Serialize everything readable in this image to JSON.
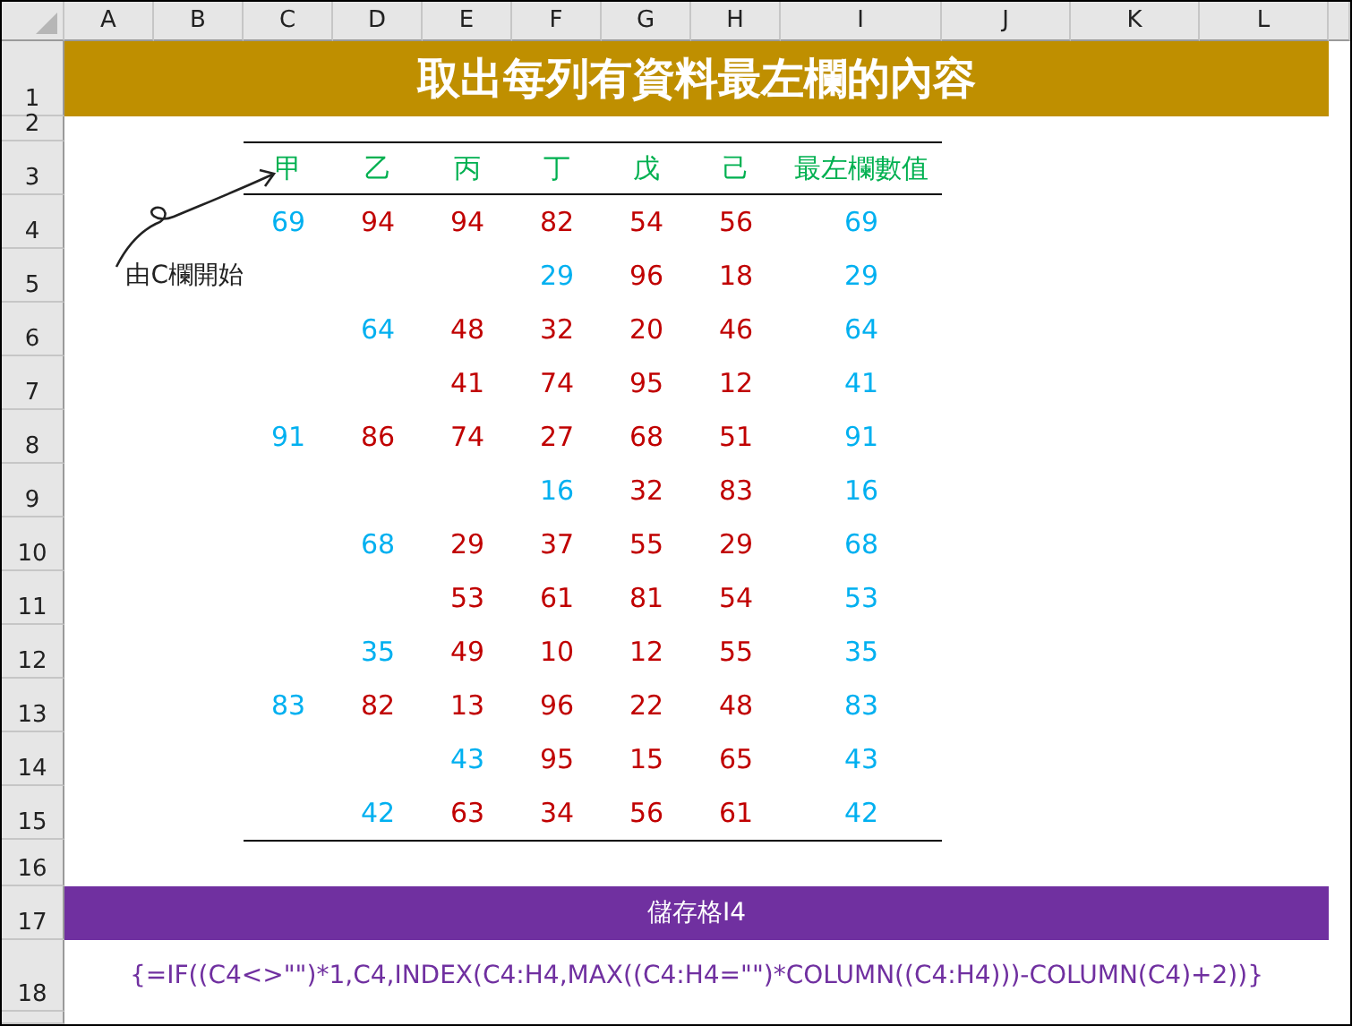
{
  "columns": [
    "A",
    "B",
    "C",
    "D",
    "E",
    "F",
    "G",
    "H",
    "I",
    "J",
    "K",
    "L"
  ],
  "row_numbers": [
    "1",
    "2",
    "3",
    "4",
    "5",
    "6",
    "7",
    "8",
    "9",
    "10",
    "11",
    "12",
    "13",
    "14",
    "15",
    "16",
    "17",
    "18"
  ],
  "title": "取出每列有資料最左欄的內容",
  "table": {
    "headers": [
      "甲",
      "乙",
      "丙",
      "丁",
      "戊",
      "己",
      "最左欄數值"
    ],
    "rows": [
      {
        "cells": [
          {
            "value": "69",
            "highlighted": true
          },
          {
            "value": "94",
            "highlighted": false
          },
          {
            "value": "94",
            "highlighted": false
          },
          {
            "value": "82",
            "highlighted": false
          },
          {
            "value": "54",
            "highlighted": false
          },
          {
            "value": "56",
            "highlighted": false
          }
        ],
        "result": "69"
      },
      {
        "cells": [
          null,
          null,
          null,
          {
            "value": "29",
            "highlighted": true
          },
          {
            "value": "96",
            "highlighted": false
          },
          {
            "value": "18",
            "highlighted": false
          }
        ],
        "result": "29"
      },
      {
        "cells": [
          null,
          {
            "value": "64",
            "highlighted": true
          },
          {
            "value": "48",
            "highlighted": false
          },
          {
            "value": "32",
            "highlighted": false
          },
          {
            "value": "20",
            "highlighted": false
          },
          {
            "value": "46",
            "highlighted": false
          }
        ],
        "result": "64"
      },
      {
        "cells": [
          null,
          null,
          {
            "value": "41",
            "highlighted": false
          },
          {
            "value": "74",
            "highlighted": false
          },
          {
            "value": "95",
            "highlighted": false
          },
          {
            "value": "12",
            "highlighted": false
          }
        ],
        "result": "41"
      },
      {
        "cells": [
          {
            "value": "91",
            "highlighted": true
          },
          {
            "value": "86",
            "highlighted": false
          },
          {
            "value": "74",
            "highlighted": false
          },
          {
            "value": "27",
            "highlighted": false
          },
          {
            "value": "68",
            "highlighted": false
          },
          {
            "value": "51",
            "highlighted": false
          }
        ],
        "result": "91"
      },
      {
        "cells": [
          null,
          null,
          null,
          {
            "value": "16",
            "highlighted": true
          },
          {
            "value": "32",
            "highlighted": false
          },
          {
            "value": "83",
            "highlighted": false
          }
        ],
        "result": "16"
      },
      {
        "cells": [
          null,
          {
            "value": "68",
            "highlighted": true
          },
          {
            "value": "29",
            "highlighted": false
          },
          {
            "value": "37",
            "highlighted": false
          },
          {
            "value": "55",
            "highlighted": false
          },
          {
            "value": "29",
            "highlighted": false
          }
        ],
        "result": "68"
      },
      {
        "cells": [
          null,
          null,
          {
            "value": "53",
            "highlighted": false
          },
          {
            "value": "61",
            "highlighted": false
          },
          {
            "value": "81",
            "highlighted": false
          },
          {
            "value": "54",
            "highlighted": false
          }
        ],
        "result": "53"
      },
      {
        "cells": [
          null,
          {
            "value": "35",
            "highlighted": true
          },
          {
            "value": "49",
            "highlighted": false
          },
          {
            "value": "10",
            "highlighted": false
          },
          {
            "value": "12",
            "highlighted": false
          },
          {
            "value": "55",
            "highlighted": false
          }
        ],
        "result": "35"
      },
      {
        "cells": [
          {
            "value": "83",
            "highlighted": true
          },
          {
            "value": "82",
            "highlighted": false
          },
          {
            "value": "13",
            "highlighted": false
          },
          {
            "value": "96",
            "highlighted": false
          },
          {
            "value": "22",
            "highlighted": false
          },
          {
            "value": "48",
            "highlighted": false
          }
        ],
        "result": "83"
      },
      {
        "cells": [
          null,
          null,
          {
            "value": "43",
            "highlighted": true
          },
          {
            "value": "95",
            "highlighted": false
          },
          {
            "value": "15",
            "highlighted": false
          },
          {
            "value": "65",
            "highlighted": false
          }
        ],
        "result": "43"
      },
      {
        "cells": [
          null,
          {
            "value": "42",
            "highlighted": true
          },
          {
            "value": "63",
            "highlighted": false
          },
          {
            "value": "34",
            "highlighted": false
          },
          {
            "value": "56",
            "highlighted": false
          },
          {
            "value": "61",
            "highlighted": false
          }
        ],
        "result": "42"
      }
    ]
  },
  "annotation": "由C欄開始",
  "formula_label": "儲存格I4",
  "formula": "{=IF((C4<>\"\")*1,C4,INDEX(C4:H4,MAX((C4:H4=\"\")*COLUMN((C4:H4)))-COLUMN(C4)+2))}"
}
